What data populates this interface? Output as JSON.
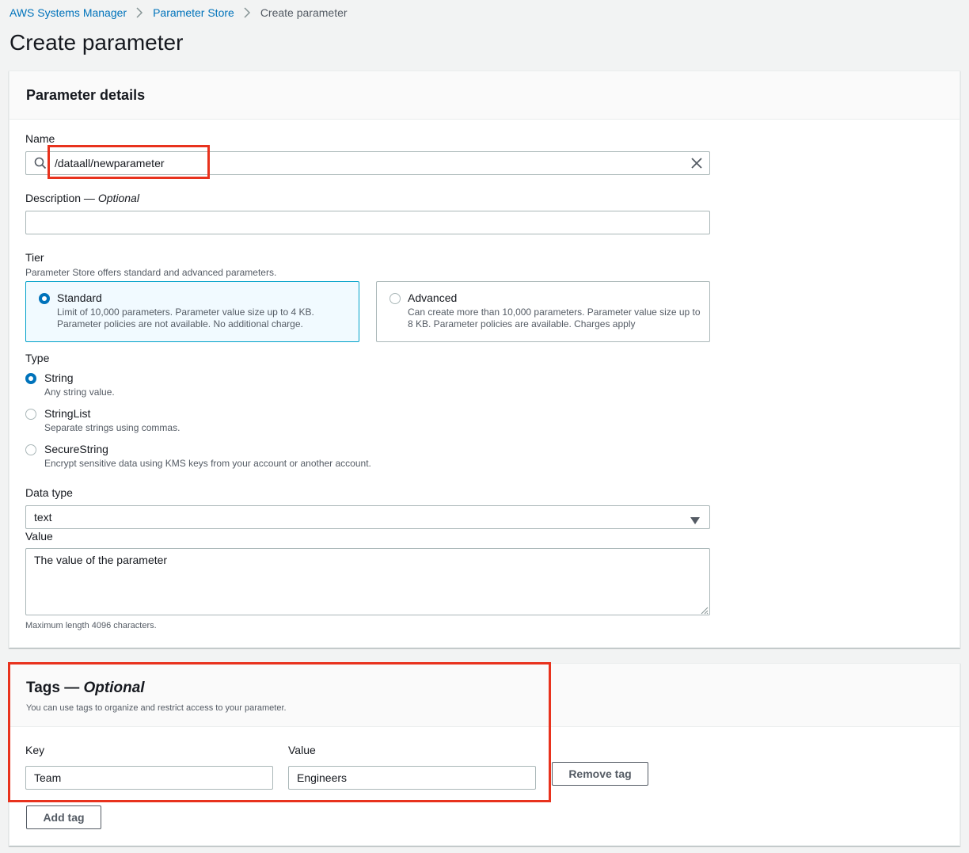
{
  "breadcrumb": {
    "items": [
      "AWS Systems Manager",
      "Parameter Store"
    ],
    "current": "Create parameter"
  },
  "page": {
    "title": "Create parameter"
  },
  "details": {
    "heading": "Parameter details",
    "name": {
      "label": "Name",
      "value": "/dataall/newparameter"
    },
    "description": {
      "label": "Description — ",
      "optional": "Optional",
      "value": ""
    },
    "tier": {
      "label": "Tier",
      "hint": "Parameter Store offers standard and advanced parameters.",
      "standard": {
        "name": "Standard",
        "desc": "Limit of 10,000 parameters. Parameter value size up to 4 KB. Parameter policies are not available. No additional charge."
      },
      "advanced": {
        "name": "Advanced",
        "desc": "Can create more than 10,000 parameters. Parameter value size up to 8 KB. Parameter policies are available. Charges apply"
      },
      "selected": "Standard"
    },
    "type": {
      "label": "Type",
      "options": [
        {
          "name": "String",
          "desc": "Any string value."
        },
        {
          "name": "StringList",
          "desc": "Separate strings using commas."
        },
        {
          "name": "SecureString",
          "desc": "Encrypt sensitive data using KMS keys from your account or another account."
        }
      ],
      "selected": "String"
    },
    "data_type": {
      "label": "Data type",
      "value": "text"
    },
    "value": {
      "label": "Value",
      "placeholder": "The value of the parameter",
      "hint": "Maximum length 4096 characters."
    }
  },
  "tags": {
    "heading": "Tags — ",
    "optional": "Optional",
    "hint": "You can use tags to organize and restrict access to your parameter.",
    "key_label": "Key",
    "value_label": "Value",
    "rows": [
      {
        "key": "Team",
        "value": "Engineers"
      }
    ],
    "remove_label": "Remove tag",
    "add_label": "Add tag"
  },
  "colors": {
    "link": "#0073bb",
    "selected_tile": "#00a1c9",
    "highlight": "#e8321d"
  },
  "icons": {
    "separator": "chevron-right-icon",
    "search": "search-icon",
    "clear": "close-icon",
    "dropdown": "caret-down-icon",
    "resize": "resize-grip-icon"
  }
}
